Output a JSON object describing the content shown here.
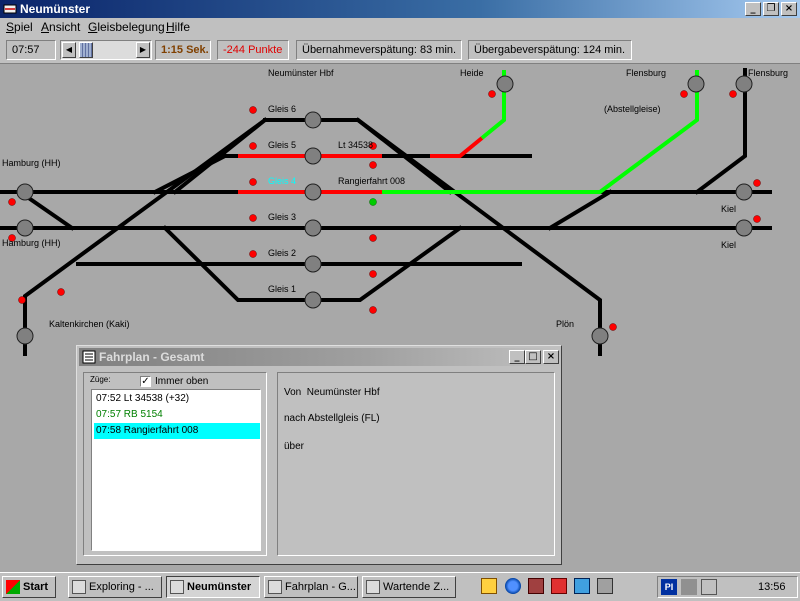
{
  "window": {
    "title": "Neumünster"
  },
  "menu": [
    {
      "label": "Spiel",
      "u": "S",
      "rest": "piel"
    },
    {
      "label": "Ansicht",
      "u": "A",
      "rest": "nsicht"
    },
    {
      "label": "Gleisbelegung",
      "u": "G",
      "rest": "leisbelegung"
    },
    {
      "label": "Hilfe",
      "u": "H",
      "rest": "ilfe"
    }
  ],
  "toolbar": {
    "time": "07:57",
    "speed": "1:15 Sek.",
    "points": "-244 Punkte",
    "takeover_delay": "Übernahmeverspätung: 83 min.",
    "handover_delay": "Übergabeverspätung: 124 min.",
    "colors": {
      "speed": "#804000",
      "points": "#e00000"
    }
  },
  "map": {
    "labels": {
      "station": "Neumünster Hbf",
      "heide": "Heide",
      "flensburg1": "Flensburg",
      "flensburg2": "Flensburg",
      "abstell": "(Abstellgleise)",
      "gleis6": "Gleis 6",
      "gleis5": "Gleis 5",
      "gleis4": "Gleis 4",
      "gleis3": "Gleis 3",
      "gleis2": "Gleis 2",
      "gleis1": "Gleis 1",
      "lt": "Lt 34538",
      "rangier": "Rangierfahrt 008",
      "hamburg1": "Hamburg (HH)",
      "hamburg2": "Hamburg (HH)",
      "kiel1": "Kiel",
      "kiel2": "Kiel",
      "kaki": "Kaltenkirchen (Kaki)",
      "ploen": "Plön"
    },
    "colors": {
      "track": "#000000",
      "occupied": "#ff0000",
      "route": "#00ff00",
      "highlight_label": "#00ffff",
      "signal_red": "#ff0000",
      "signal_green": "#00cc00",
      "node": "#808080"
    }
  },
  "fahrplan": {
    "title": "Fahrplan - Gesamt",
    "trains_label": "Züge:",
    "always_on_top": "Immer oben",
    "always_on_top_checked": true,
    "trains": [
      {
        "text": "07:52 Lt 34538 (+32)",
        "color": "#000000",
        "selected": false
      },
      {
        "text": "07:57 RB 5154",
        "color": "#008000",
        "selected": false
      },
      {
        "text": "07:58 Rangierfahrt 008",
        "color": "#000000",
        "selected": true
      }
    ],
    "from_label": "Von  Neumünster Hbf",
    "to_label": "nach Abstellgleis (FL)",
    "via_label": "über"
  },
  "taskbar": {
    "start": "Start",
    "buttons": [
      {
        "label": "Exploring - ...",
        "active": false
      },
      {
        "label": "Neumünster",
        "active": true
      },
      {
        "label": "Fahrplan - G...",
        "active": false
      },
      {
        "label": "Wartende Z...",
        "active": false
      }
    ],
    "clock": "13:56"
  }
}
